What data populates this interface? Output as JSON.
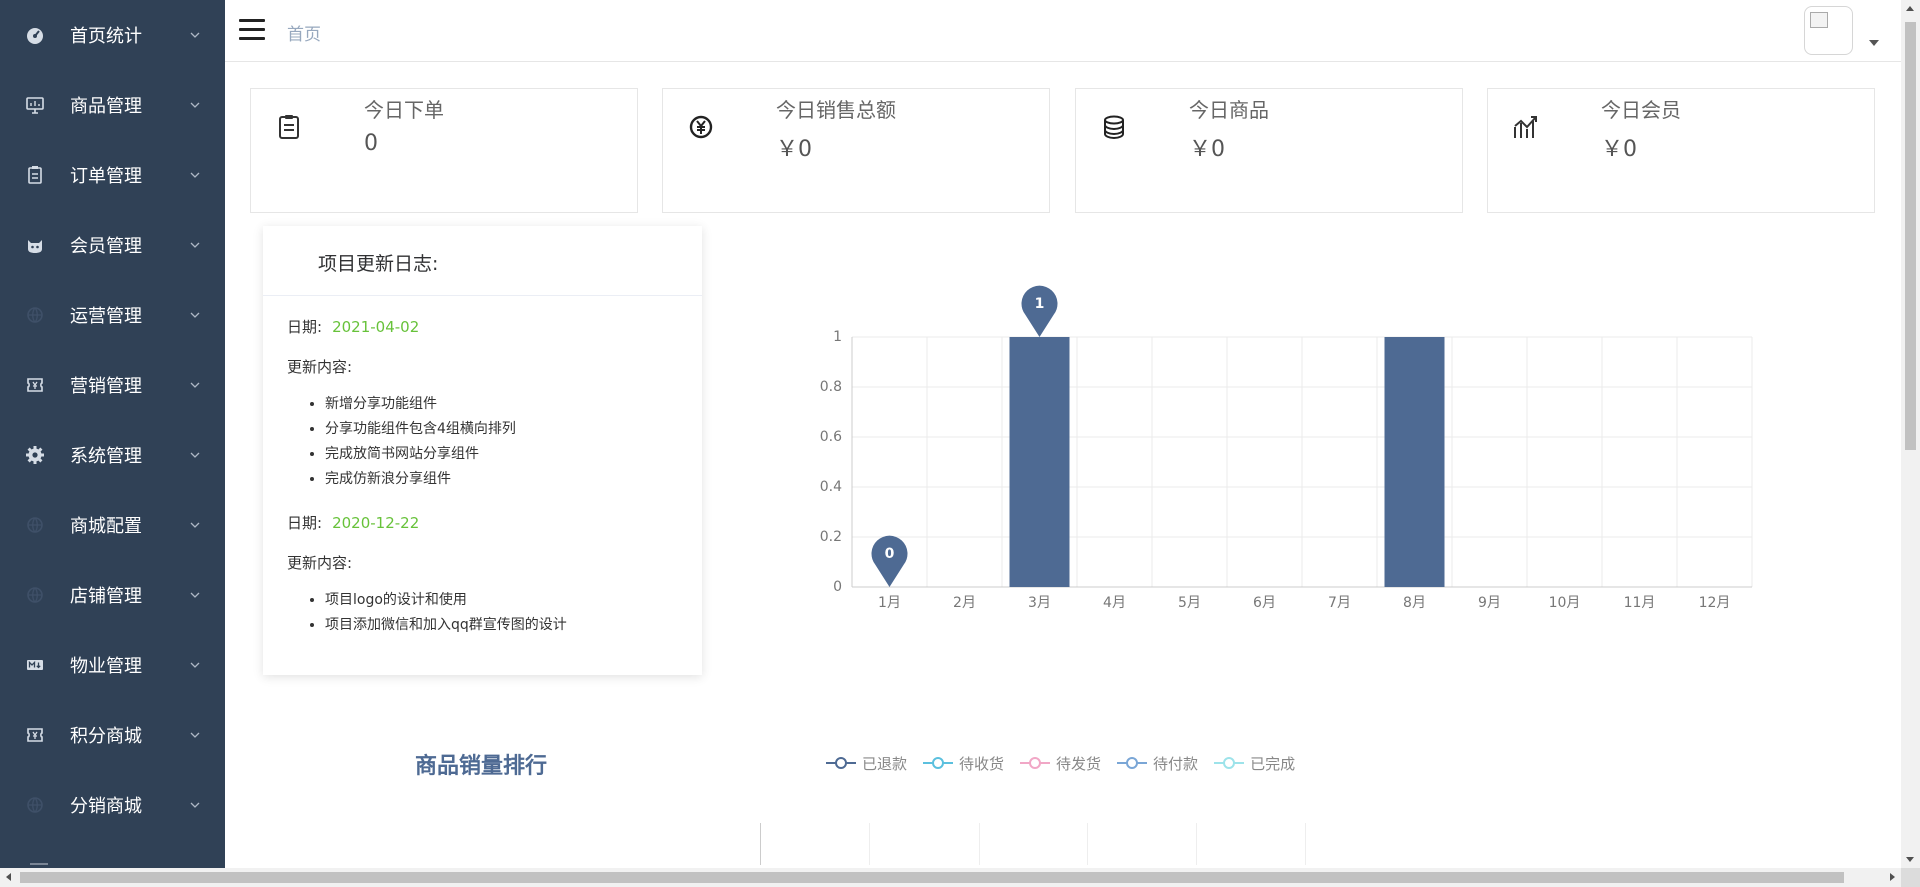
{
  "sidebar": {
    "items": [
      {
        "label": "首页统计",
        "icon": "dashboard-icon"
      },
      {
        "label": "商品管理",
        "icon": "monitor-icon"
      },
      {
        "label": "订单管理",
        "icon": "clipboard-icon"
      },
      {
        "label": "会员管理",
        "icon": "cat-icon"
      },
      {
        "label": "运营管理",
        "icon": "globe-icon"
      },
      {
        "label": "营销管理",
        "icon": "ticket-icon"
      },
      {
        "label": "系统管理",
        "icon": "gear-icon"
      },
      {
        "label": "商城配置",
        "icon": "globe-icon"
      },
      {
        "label": "店铺管理",
        "icon": "globe-icon"
      },
      {
        "label": "物业管理",
        "icon": "markdown-icon"
      },
      {
        "label": "积分商城",
        "icon": "ticket-icon"
      },
      {
        "label": "分销商城",
        "icon": "globe-icon"
      }
    ]
  },
  "header": {
    "breadcrumb": "首页"
  },
  "stats": [
    {
      "title": "今日下单",
      "value": "0",
      "icon": "clipboard-icon"
    },
    {
      "title": "今日销售总额",
      "value": "￥0",
      "icon": "yen-icon"
    },
    {
      "title": "今日商品",
      "value": "￥0",
      "icon": "coins-icon"
    },
    {
      "title": "今日会员",
      "value": "￥0",
      "icon": "trend-icon"
    }
  ],
  "update_log": {
    "title": "项目更新日志:",
    "entries": [
      {
        "date_label": "日期:",
        "date": "2021-04-02",
        "content_label": "更新内容:",
        "items": [
          "新增分享功能组件",
          "分享功能组件包含4组横向排列",
          "完成放简书网站分享组件",
          "完成仿新浪分享组件"
        ]
      },
      {
        "date_label": "日期:",
        "date": "2020-12-22",
        "content_label": "更新内容:",
        "items": [
          "项目logo的设计和使用",
          "项目添加微信和加入qq群宣传图的设计"
        ]
      }
    ]
  },
  "colors": {
    "sidebar_bg": "#304156",
    "bar": "#4e6a93",
    "date": "#67c23a"
  },
  "chart_data": {
    "type": "bar",
    "categories": [
      "1月",
      "2月",
      "3月",
      "4月",
      "5月",
      "6月",
      "7月",
      "8月",
      "9月",
      "10月",
      "11月",
      "12月"
    ],
    "values": [
      0,
      0,
      1,
      0,
      0,
      0,
      0,
      1,
      0,
      0,
      0,
      0
    ],
    "ylim": [
      0,
      1
    ],
    "yticks": [
      "0",
      "0.2",
      "0.4",
      "0.6",
      "0.8",
      "1"
    ],
    "grid": true,
    "markers": [
      {
        "category": "1月",
        "label": "0"
      },
      {
        "category": "3月",
        "label": "1"
      }
    ]
  },
  "sales_rank": {
    "title": "商品销量排行",
    "legend": [
      {
        "label": "已退款",
        "color": "#4e6a93"
      },
      {
        "label": "待收货",
        "color": "#5bc0de"
      },
      {
        "label": "待发货",
        "color": "#f1a7c6"
      },
      {
        "label": "待付款",
        "color": "#7aa6d6"
      },
      {
        "label": "已完成",
        "color": "#9de3ea"
      }
    ]
  }
}
